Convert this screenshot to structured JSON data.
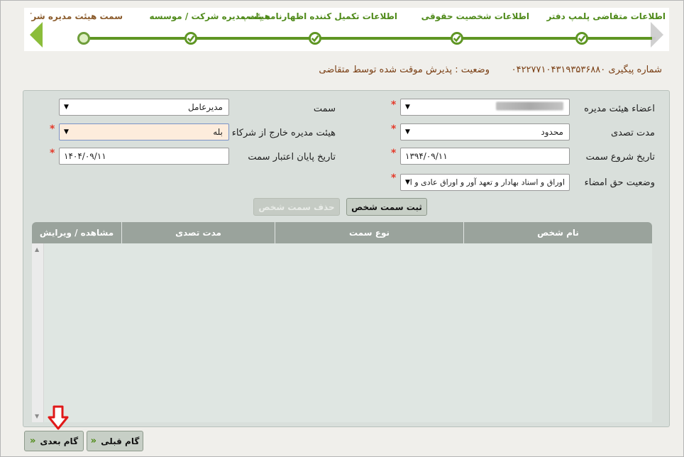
{
  "wizard": {
    "steps": [
      {
        "label": "اطلاعات متقاضی پلمپ دفتر",
        "state": "done"
      },
      {
        "label": "اطلاعات شخصیت حقوقی",
        "state": "done"
      },
      {
        "label": "اطلاعات تکمیل کننده اظهارنامه پلمپ",
        "state": "done"
      },
      {
        "label": "هیئت مدیره شرکت / موسسه",
        "state": "done"
      },
      {
        "label": "سمت هیئت مدیره شرکت مو",
        "state": "current"
      }
    ],
    "accent": "#5f9624"
  },
  "status": {
    "tracking_label": "شماره پیگیری ۰۴۲۲۷۷۱۰۴۳۱۹۳۵۳۶۸۸۰",
    "state_label": "وضعیت : پذیرش موقت شده توسط متقاضی"
  },
  "form": {
    "board_member_label": "اعضاء هیئت مدیره",
    "position_label": "سمت",
    "position_value": "مدیرعامل",
    "term_label": "مدت تصدی",
    "term_value": "محدود",
    "outside_label": "هیئت مدیره خارج از شرکاء",
    "outside_value": "بله",
    "start_label": "تاریخ شروع سمت",
    "start_value": "۱۳۹۴/۰۹/۱۱",
    "end_label": "تاریخ پایان اعتبار سمت",
    "end_value": "۱۴۰۴/۰۹/۱۱",
    "signature_label": "وضعیت حق امضاء",
    "signature_value": "اوراق و اسناد بهادار و تعهد آور و اوراق عادی و ا",
    "required_mark": "*",
    "dropdown_arrow": "▼"
  },
  "actions": {
    "register_label": "ثبت سمت شخص",
    "delete_label": "حذف سمت شخص"
  },
  "grid": {
    "columns": [
      "نام شخص",
      "نوع سمت",
      "مدت تصدی",
      "مشاهده / ویرایش"
    ],
    "rows": []
  },
  "nav": {
    "next_label": "گام بعدی",
    "prev_label": "گام قبلی",
    "next_chev": "«",
    "prev_chev": "«"
  }
}
